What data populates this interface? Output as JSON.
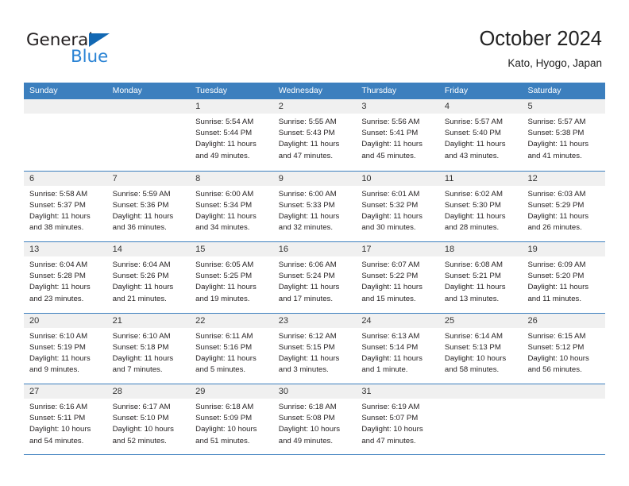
{
  "brand": {
    "name_part1": "General",
    "name_part2": "Blue",
    "triangle_color": "#1268b3",
    "blue_color": "#2a83d4"
  },
  "header": {
    "title": "October 2024",
    "subtitle": "Kato, Hyogo, Japan"
  },
  "theme": {
    "header_band": "#3c7fbe",
    "day_number_band": "#f0f0f0",
    "text": "#231f20"
  },
  "weekdays": [
    "Sunday",
    "Monday",
    "Tuesday",
    "Wednesday",
    "Thursday",
    "Friday",
    "Saturday"
  ],
  "weeks": [
    [
      {
        "day": "",
        "lines": []
      },
      {
        "day": "",
        "lines": []
      },
      {
        "day": "1",
        "lines": [
          "Sunrise: 5:54 AM",
          "Sunset: 5:44 PM",
          "Daylight: 11 hours",
          "and 49 minutes."
        ]
      },
      {
        "day": "2",
        "lines": [
          "Sunrise: 5:55 AM",
          "Sunset: 5:43 PM",
          "Daylight: 11 hours",
          "and 47 minutes."
        ]
      },
      {
        "day": "3",
        "lines": [
          "Sunrise: 5:56 AM",
          "Sunset: 5:41 PM",
          "Daylight: 11 hours",
          "and 45 minutes."
        ]
      },
      {
        "day": "4",
        "lines": [
          "Sunrise: 5:57 AM",
          "Sunset: 5:40 PM",
          "Daylight: 11 hours",
          "and 43 minutes."
        ]
      },
      {
        "day": "5",
        "lines": [
          "Sunrise: 5:57 AM",
          "Sunset: 5:38 PM",
          "Daylight: 11 hours",
          "and 41 minutes."
        ]
      }
    ],
    [
      {
        "day": "6",
        "lines": [
          "Sunrise: 5:58 AM",
          "Sunset: 5:37 PM",
          "Daylight: 11 hours",
          "and 38 minutes."
        ]
      },
      {
        "day": "7",
        "lines": [
          "Sunrise: 5:59 AM",
          "Sunset: 5:36 PM",
          "Daylight: 11 hours",
          "and 36 minutes."
        ]
      },
      {
        "day": "8",
        "lines": [
          "Sunrise: 6:00 AM",
          "Sunset: 5:34 PM",
          "Daylight: 11 hours",
          "and 34 minutes."
        ]
      },
      {
        "day": "9",
        "lines": [
          "Sunrise: 6:00 AM",
          "Sunset: 5:33 PM",
          "Daylight: 11 hours",
          "and 32 minutes."
        ]
      },
      {
        "day": "10",
        "lines": [
          "Sunrise: 6:01 AM",
          "Sunset: 5:32 PM",
          "Daylight: 11 hours",
          "and 30 minutes."
        ]
      },
      {
        "day": "11",
        "lines": [
          "Sunrise: 6:02 AM",
          "Sunset: 5:30 PM",
          "Daylight: 11 hours",
          "and 28 minutes."
        ]
      },
      {
        "day": "12",
        "lines": [
          "Sunrise: 6:03 AM",
          "Sunset: 5:29 PM",
          "Daylight: 11 hours",
          "and 26 minutes."
        ]
      }
    ],
    [
      {
        "day": "13",
        "lines": [
          "Sunrise: 6:04 AM",
          "Sunset: 5:28 PM",
          "Daylight: 11 hours",
          "and 23 minutes."
        ]
      },
      {
        "day": "14",
        "lines": [
          "Sunrise: 6:04 AM",
          "Sunset: 5:26 PM",
          "Daylight: 11 hours",
          "and 21 minutes."
        ]
      },
      {
        "day": "15",
        "lines": [
          "Sunrise: 6:05 AM",
          "Sunset: 5:25 PM",
          "Daylight: 11 hours",
          "and 19 minutes."
        ]
      },
      {
        "day": "16",
        "lines": [
          "Sunrise: 6:06 AM",
          "Sunset: 5:24 PM",
          "Daylight: 11 hours",
          "and 17 minutes."
        ]
      },
      {
        "day": "17",
        "lines": [
          "Sunrise: 6:07 AM",
          "Sunset: 5:22 PM",
          "Daylight: 11 hours",
          "and 15 minutes."
        ]
      },
      {
        "day": "18",
        "lines": [
          "Sunrise: 6:08 AM",
          "Sunset: 5:21 PM",
          "Daylight: 11 hours",
          "and 13 minutes."
        ]
      },
      {
        "day": "19",
        "lines": [
          "Sunrise: 6:09 AM",
          "Sunset: 5:20 PM",
          "Daylight: 11 hours",
          "and 11 minutes."
        ]
      }
    ],
    [
      {
        "day": "20",
        "lines": [
          "Sunrise: 6:10 AM",
          "Sunset: 5:19 PM",
          "Daylight: 11 hours",
          "and 9 minutes."
        ]
      },
      {
        "day": "21",
        "lines": [
          "Sunrise: 6:10 AM",
          "Sunset: 5:18 PM",
          "Daylight: 11 hours",
          "and 7 minutes."
        ]
      },
      {
        "day": "22",
        "lines": [
          "Sunrise: 6:11 AM",
          "Sunset: 5:16 PM",
          "Daylight: 11 hours",
          "and 5 minutes."
        ]
      },
      {
        "day": "23",
        "lines": [
          "Sunrise: 6:12 AM",
          "Sunset: 5:15 PM",
          "Daylight: 11 hours",
          "and 3 minutes."
        ]
      },
      {
        "day": "24",
        "lines": [
          "Sunrise: 6:13 AM",
          "Sunset: 5:14 PM",
          "Daylight: 11 hours",
          "and 1 minute."
        ]
      },
      {
        "day": "25",
        "lines": [
          "Sunrise: 6:14 AM",
          "Sunset: 5:13 PM",
          "Daylight: 10 hours",
          "and 58 minutes."
        ]
      },
      {
        "day": "26",
        "lines": [
          "Sunrise: 6:15 AM",
          "Sunset: 5:12 PM",
          "Daylight: 10 hours",
          "and 56 minutes."
        ]
      }
    ],
    [
      {
        "day": "27",
        "lines": [
          "Sunrise: 6:16 AM",
          "Sunset: 5:11 PM",
          "Daylight: 10 hours",
          "and 54 minutes."
        ]
      },
      {
        "day": "28",
        "lines": [
          "Sunrise: 6:17 AM",
          "Sunset: 5:10 PM",
          "Daylight: 10 hours",
          "and 52 minutes."
        ]
      },
      {
        "day": "29",
        "lines": [
          "Sunrise: 6:18 AM",
          "Sunset: 5:09 PM",
          "Daylight: 10 hours",
          "and 51 minutes."
        ]
      },
      {
        "day": "30",
        "lines": [
          "Sunrise: 6:18 AM",
          "Sunset: 5:08 PM",
          "Daylight: 10 hours",
          "and 49 minutes."
        ]
      },
      {
        "day": "31",
        "lines": [
          "Sunrise: 6:19 AM",
          "Sunset: 5:07 PM",
          "Daylight: 10 hours",
          "and 47 minutes."
        ]
      },
      {
        "day": "",
        "lines": []
      },
      {
        "day": "",
        "lines": []
      }
    ]
  ]
}
